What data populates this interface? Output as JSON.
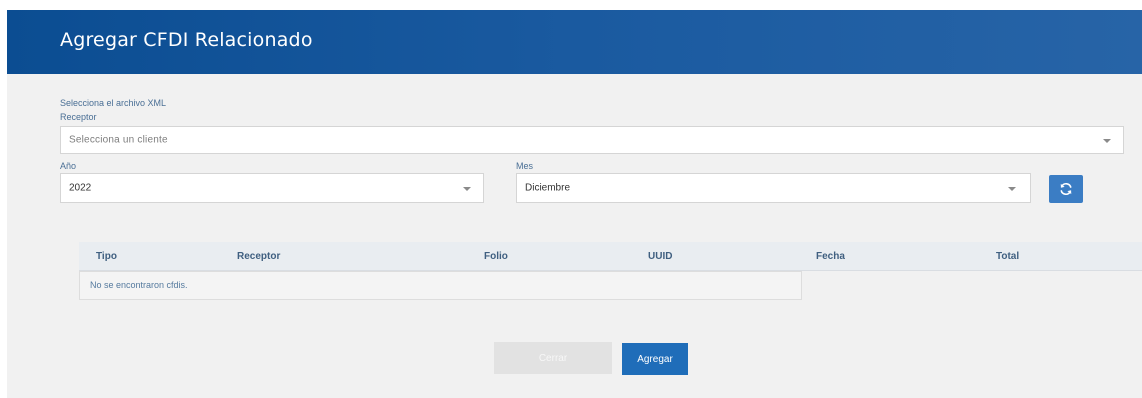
{
  "modal": {
    "title": "Agregar CFDI Relacionado"
  },
  "form": {
    "xml_label": "Selecciona el archivo XML",
    "receptor_label": "Receptor",
    "receptor_placeholder": "Selecciona un cliente",
    "anio_label": "Año",
    "anio_value": "2022",
    "mes_label": "Mes",
    "mes_value": "Diciembre",
    "refresh_icon": "refresh-icon"
  },
  "table": {
    "columns": [
      "Tipo",
      "Receptor",
      "Folio",
      "UUID",
      "Fecha",
      "Total"
    ],
    "empty_message": "No se encontraron cfdis."
  },
  "footer": {
    "cerrar_label": "Cerrar",
    "agregar_label": "Agregar"
  },
  "colors": {
    "header_blue": "#1a5aa0",
    "primary_button": "#1f6db9",
    "refresh_button": "#3b7dc4",
    "disabled_button": "#e2e2e2"
  }
}
